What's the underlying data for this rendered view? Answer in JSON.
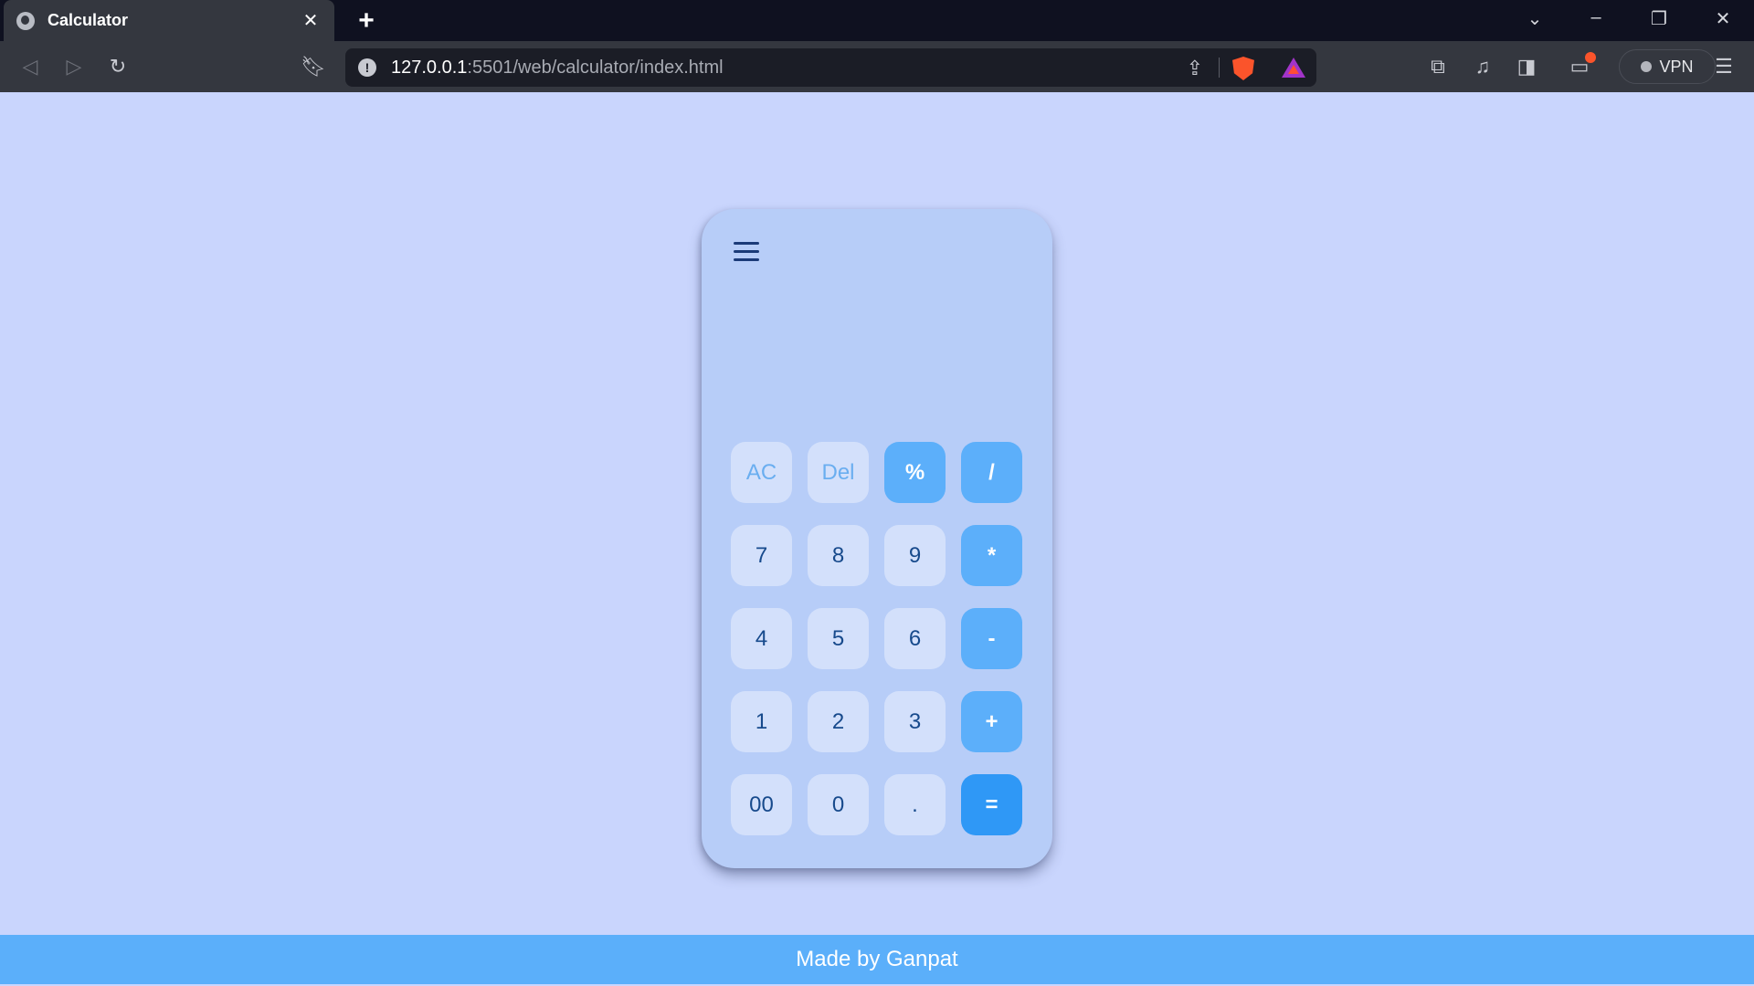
{
  "browser": {
    "tab_title": "Calculator",
    "url_host": "127.0.0.1",
    "url_path": ":5501/web/calculator/index.html",
    "vpn_label": "VPN"
  },
  "calculator": {
    "display_value": "",
    "keys": [
      {
        "label": "AC",
        "kind": "light"
      },
      {
        "label": "Del",
        "kind": "light"
      },
      {
        "label": "%",
        "kind": "op"
      },
      {
        "label": "/",
        "kind": "op"
      },
      {
        "label": "7",
        "kind": "num"
      },
      {
        "label": "8",
        "kind": "num"
      },
      {
        "label": "9",
        "kind": "num"
      },
      {
        "label": "*",
        "kind": "op"
      },
      {
        "label": "4",
        "kind": "num"
      },
      {
        "label": "5",
        "kind": "num"
      },
      {
        "label": "6",
        "kind": "num"
      },
      {
        "label": "-",
        "kind": "op"
      },
      {
        "label": "1",
        "kind": "num"
      },
      {
        "label": "2",
        "kind": "num"
      },
      {
        "label": "3",
        "kind": "num"
      },
      {
        "label": "+",
        "kind": "op"
      },
      {
        "label": "00",
        "kind": "num"
      },
      {
        "label": "0",
        "kind": "num"
      },
      {
        "label": ".",
        "kind": "num"
      },
      {
        "label": "=",
        "kind": "eq"
      }
    ]
  },
  "footer": {
    "text": "Made by Ganpat"
  },
  "colors": {
    "page_bg": "#c9d5fd",
    "calc_bg": "#b7cdf8",
    "key_bg": "#d3e0fb",
    "op_bg": "#5caffa",
    "eq_bg": "#2f98f6",
    "footer_bg": "#5baffa",
    "text_dark": "#174a8c"
  }
}
